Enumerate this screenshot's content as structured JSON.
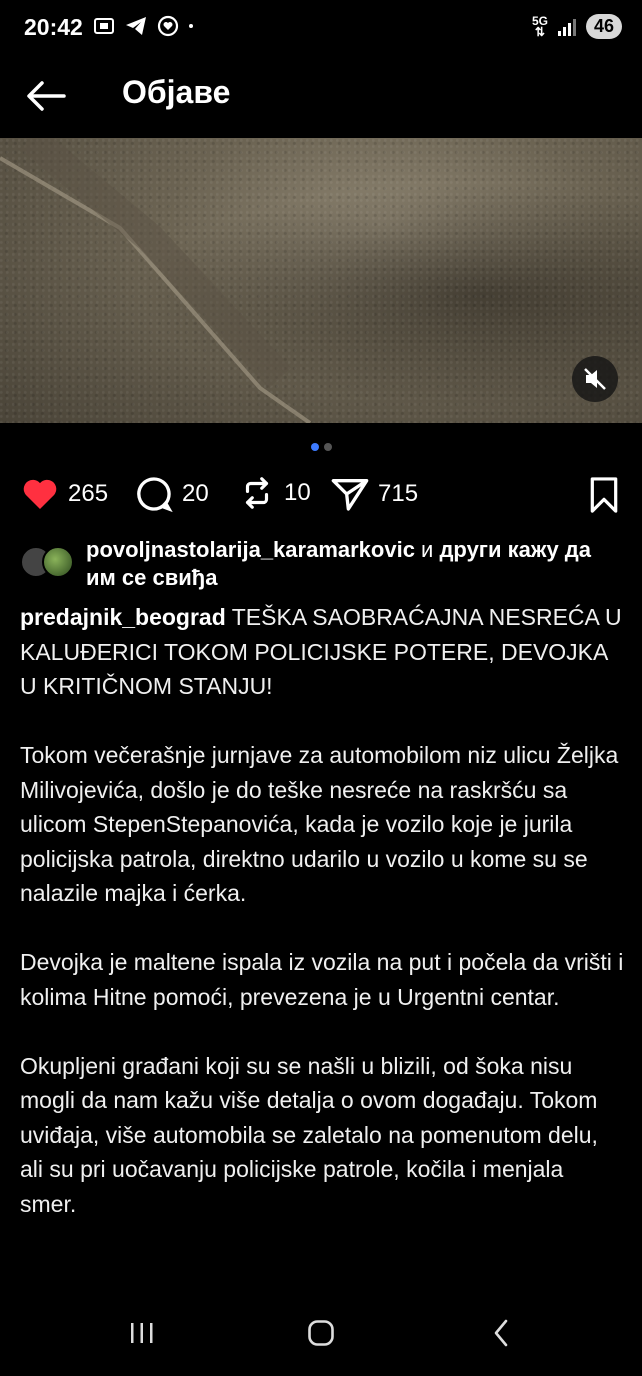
{
  "status": {
    "time": "20:42",
    "network": "5G",
    "battery": "46"
  },
  "header": {
    "title": "Објаве"
  },
  "media": {
    "page_count": 2,
    "active_page": 1
  },
  "actions": {
    "likes": "265",
    "comments": "20",
    "reposts": "10",
    "shares": "715"
  },
  "likes": {
    "user": "povoljnastolarija_karamarkovic",
    "connector": " и ",
    "rest": "други кажу да им се свиђа"
  },
  "caption": {
    "username": "predajnik_beograd",
    "headline": " TEŠKA SAOBRAĆAJNA NESREĆA U KALUĐERICI TOKOM POLICIJSKE POTERE, DEVOJKA U KRITIČNOM STANJU!",
    "paragraph1": "Tokom večerašnje jurnjave za automobilom niz ulicu Željka Milivojevića, došlo je do teške nesreće na raskršću sa ulicom StepenStepanovića, kada je vozilo koje je jurila policijska patrola, direktno udarilo u vozilo u kome su se nalazile majka i ćerka.",
    "paragraph2": "Devojka je maltene ispala iz vozila na put i počela da vrišti i kolima Hitne pomoći, prevezena je u Urgentni centar.",
    "paragraph3": "Okupljeni građani koji su se našli u blizili, od šoka nisu mogli da nam kažu više detalja o ovom događaju. Tokom uviđaja, više automobila se zaletalo na pomenutom delu, ali su pri uočavanju policijske patrole, kočila i menjala smer."
  },
  "colors": {
    "like_red": "#ff3040",
    "dot_active": "#3d7bff"
  }
}
